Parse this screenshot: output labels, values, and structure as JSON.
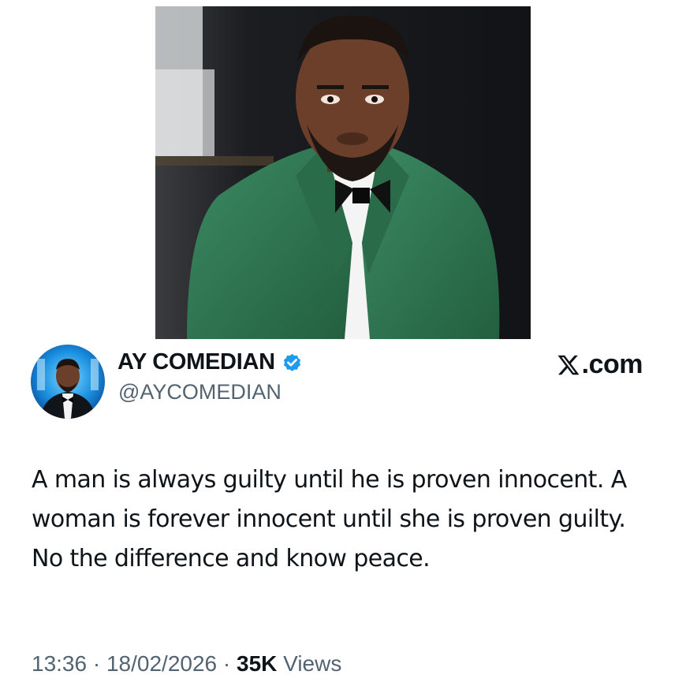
{
  "post": {
    "photo_icon": "portrait-photo",
    "avatar_icon": "profile-avatar",
    "author": {
      "display_name": "AY COMEDIAN",
      "handle": "@AYCOMEDIAN",
      "verified": true,
      "verified_icon": "verified-badge-icon"
    },
    "site": {
      "logo_icon": "x-logo-icon",
      "label": ".com"
    },
    "text": "A man is always guilty until he is proven innocent. A woman is forever innocent until she is proven guilty. No the difference and know peace.",
    "meta": {
      "time": "13:36",
      "separator": "·",
      "date": "18/02/2026",
      "views_count": "35K",
      "views_label": "Views"
    }
  },
  "colors": {
    "text": "#0f1419",
    "secondary_text": "#536471",
    "verified_blue": "#1d9bf0",
    "suit_green": "#2f7a55"
  }
}
